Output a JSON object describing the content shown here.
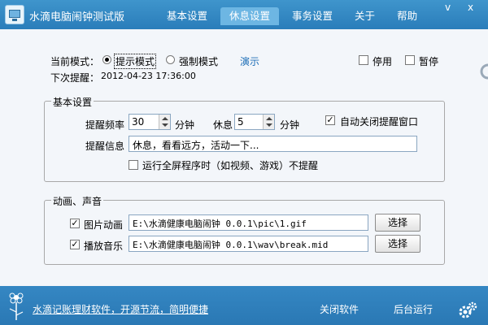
{
  "window": {
    "title": "水滴电脑闹钟测试版",
    "minimize_glyph": "v",
    "close_glyph": "x"
  },
  "tabs": [
    {
      "label": "基本设置",
      "active": false
    },
    {
      "label": "休息设置",
      "active": true
    },
    {
      "label": "事务设置",
      "active": false
    },
    {
      "label": "关于",
      "active": false
    },
    {
      "label": "帮助",
      "active": false
    }
  ],
  "mode": {
    "label": "当前模式：",
    "options": [
      {
        "label": "提示模式",
        "selected": true
      },
      {
        "label": "强制模式",
        "selected": false
      }
    ],
    "demo_link": "演示",
    "stop_label": "停用",
    "stop_checked": false,
    "pause_label": "暂停",
    "pause_checked": false
  },
  "next_reminder": {
    "label": "下次提醒：",
    "value": "2012-04-23 17:36:00"
  },
  "basic_settings": {
    "title": "基本设置",
    "frequency_label": "提醒频率",
    "frequency_value": "30",
    "frequency_unit": "分钟",
    "rest_label": "休息",
    "rest_value": "5",
    "rest_unit": "分钟",
    "auto_close_label": "自动关闭提醒窗口",
    "auto_close_checked": true,
    "message_label": "提醒信息",
    "message_value": "休息，看看远方，活动一下...",
    "fullscreen_label": "运行全屏程序时（如视频、游戏）不提醒",
    "fullscreen_checked": false
  },
  "media": {
    "title": "动画、声音",
    "image_label": "图片动画",
    "image_checked": true,
    "image_path": "E:\\水滴健康电脑闹钟 0.0.1\\pic\\1.gif",
    "music_label": "播放音乐",
    "music_checked": true,
    "music_path": "E:\\水滴健康电脑闹钟 0.0.1\\wav\\break.mid",
    "select_label": "选择"
  },
  "footer": {
    "link": "水滴记账理财软件，开源节流，简明便捷",
    "close_app": "关闭软件",
    "background_run": "后台运行"
  },
  "colors": {
    "titlebar": "#3587c3",
    "active_tab": "#6db6e3",
    "link": "#1f6fb7"
  }
}
